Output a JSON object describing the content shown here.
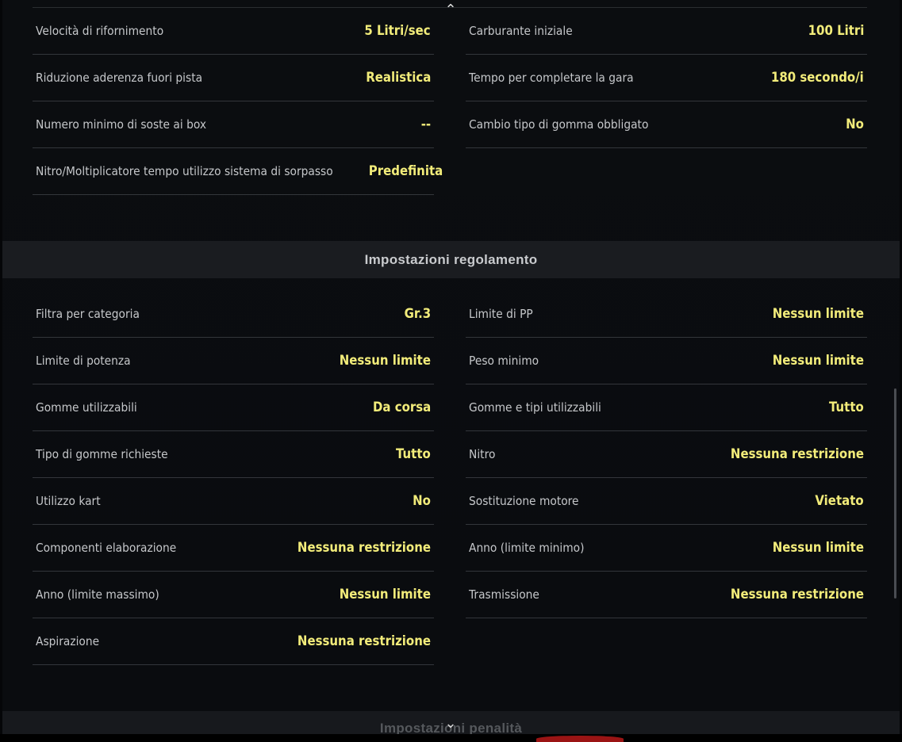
{
  "top_section": {
    "left": [
      {
        "label": "Velocità di rifornimento",
        "value": "5 Litri/sec"
      },
      {
        "label": "Riduzione aderenza fuori pista",
        "value": "Realistica"
      },
      {
        "label": "Numero minimo di soste ai box",
        "value": "--"
      },
      {
        "label": "Nitro/Moltiplicatore tempo utilizzo sistema di sorpasso",
        "value": "Predefinita"
      }
    ],
    "right": [
      {
        "label": "Carburante iniziale",
        "value": "100 Litri"
      },
      {
        "label": "Tempo per completare la gara",
        "value": "180 secondo/i"
      },
      {
        "label": "Cambio tipo di gomma obbligato",
        "value": "No"
      }
    ]
  },
  "regulation_section": {
    "title": "Impostazioni regolamento",
    "left": [
      {
        "label": "Filtra per categoria",
        "value": "Gr.3"
      },
      {
        "label": "Limite di potenza",
        "value": "Nessun limite"
      },
      {
        "label": "Gomme utilizzabili",
        "value": "Da corsa"
      },
      {
        "label": "Tipo di gomme richieste",
        "value": "Tutto"
      },
      {
        "label": "Utilizzo kart",
        "value": "No"
      },
      {
        "label": "Componenti elaborazione",
        "value": "Nessuna restrizione"
      },
      {
        "label": "Anno (limite massimo)",
        "value": "Nessun limite"
      },
      {
        "label": "Aspirazione",
        "value": "Nessuna restrizione"
      }
    ],
    "right": [
      {
        "label": "Limite di PP",
        "value": "Nessun limite"
      },
      {
        "label": "Peso minimo",
        "value": "Nessun limite"
      },
      {
        "label": "Gomme e tipi utilizzabili",
        "value": "Tutto"
      },
      {
        "label": "Nitro",
        "value": "Nessuna restrizione"
      },
      {
        "label": "Sostituzione motore",
        "value": "Vietato"
      },
      {
        "label": "Anno (limite minimo)",
        "value": "Nessun limite"
      },
      {
        "label": "Trasmissione",
        "value": "Nessuna restrizione"
      }
    ]
  },
  "penalty_section": {
    "title": "Impostazioni penalità"
  },
  "icons": {
    "scroll_up": "chevron-up-icon",
    "scroll_down": "chevron-down-icon"
  },
  "colors": {
    "value": "#f2ec7a",
    "label": "#c5c7ca",
    "background": "#0b0d10",
    "header": "#1a1c20"
  }
}
